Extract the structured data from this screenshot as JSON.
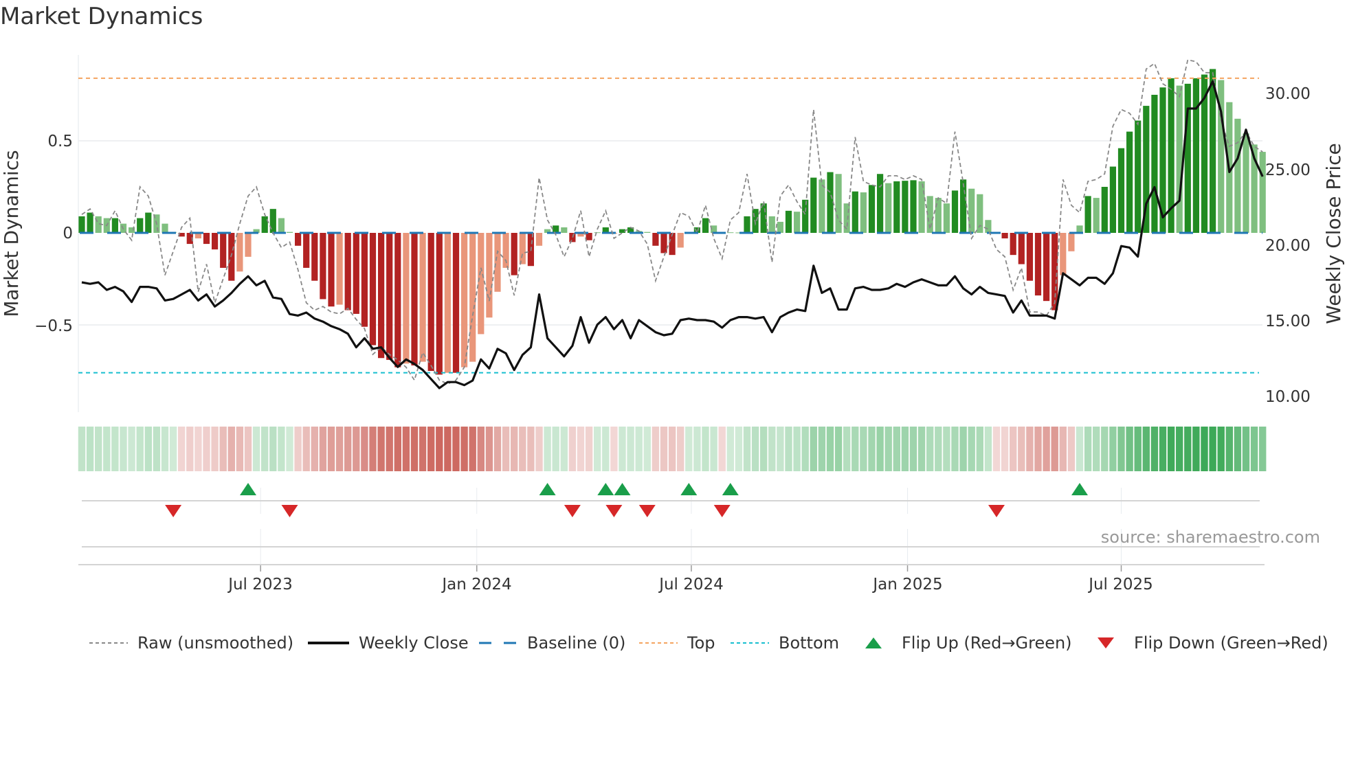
{
  "title": "Market Dynamics",
  "source": "source: sharemaestro.com",
  "colors": {
    "green_dark": "#228b22",
    "green_light": "#7fbf7f",
    "red_dark": "#b22222",
    "red_light": "#e9967a",
    "raw": "#888888",
    "close": "#111111",
    "baseline": "#1f77b4",
    "top": "#f4a460",
    "bottom": "#17becf",
    "flip_up": "#1a9e4a",
    "flip_down": "#d62728"
  },
  "legend": [
    {
      "label": "Raw (unsmoothed)",
      "icon": "dashed-gray-line"
    },
    {
      "label": "Weekly Close",
      "icon": "solid-black-line"
    },
    {
      "label": "Baseline (0)",
      "icon": "dashed-blue-line"
    },
    {
      "label": "Top",
      "icon": "dotted-orange-line"
    },
    {
      "label": "Bottom",
      "icon": "dotted-cyan-line"
    },
    {
      "label": "Flip Up (Red→Green)",
      "icon": "triangle-up"
    },
    {
      "label": "Flip Down (Green→Red)",
      "icon": "triangle-down"
    }
  ],
  "chart_data": {
    "type": "bar",
    "title": "Market Dynamics",
    "ylabel": "Market Dynamics",
    "y2label": "Weekly Close Price",
    "frequency": "weekly",
    "ylim": [
      -0.97,
      1.0
    ],
    "y2lim": [
      9.0,
      33.0
    ],
    "left_ticks": [
      "0.5",
      "0",
      "−0.5"
    ],
    "left_tick_values": [
      0.5,
      0,
      -0.5
    ],
    "right_ticks": [
      "30.00",
      "25.00",
      "20.00",
      "15.00",
      "10.00"
    ],
    "right_tick_values": [
      30,
      25,
      20,
      15,
      10
    ],
    "x_ticks": [
      "Jul 2023",
      "Jan 2024",
      "Jul 2024",
      "Jan 2025",
      "Jul 2025"
    ],
    "x_tick_week_index": [
      21.5,
      47.5,
      73.3,
      99.3,
      125
    ],
    "top_level": 0.84,
    "bottom_level": -0.76,
    "baseline": 0,
    "momentum": [
      0.09,
      0.11,
      0.09,
      0.08,
      0.08,
      0.05,
      0.03,
      0.08,
      0.11,
      0.1,
      0.05,
      0.005,
      -0.02,
      -0.06,
      -0.03,
      -0.06,
      -0.09,
      -0.19,
      -0.26,
      -0.21,
      -0.13,
      0.02,
      0.09,
      0.13,
      0.08,
      0.005,
      -0.07,
      -0.19,
      -0.26,
      -0.36,
      -0.4,
      -0.39,
      -0.42,
      -0.44,
      -0.51,
      -0.61,
      -0.68,
      -0.69,
      -0.73,
      -0.71,
      -0.72,
      -0.7,
      -0.75,
      -0.77,
      -0.76,
      -0.76,
      -0.73,
      -0.7,
      -0.55,
      -0.46,
      -0.32,
      -0.19,
      -0.23,
      -0.17,
      -0.18,
      -0.07,
      0.02,
      0.04,
      0.03,
      -0.05,
      -0.02,
      -0.04,
      0.003,
      0.03,
      -0.003,
      0.02,
      0.03,
      0.01,
      0.005,
      -0.07,
      -0.11,
      -0.12,
      -0.08,
      0.003,
      0.03,
      0.08,
      0.04,
      -0.005,
      0.003,
      0.002,
      0.09,
      0.13,
      0.16,
      0.09,
      0.06,
      0.12,
      0.115,
      0.18,
      0.3,
      0.29,
      0.33,
      0.32,
      0.16,
      0.225,
      0.22,
      0.26,
      0.32,
      0.27,
      0.28,
      0.283,
      0.286,
      0.28,
      0.2,
      0.19,
      0.16,
      0.23,
      0.29,
      0.24,
      0.21,
      0.07,
      -0.005,
      -0.03,
      -0.12,
      -0.17,
      -0.26,
      -0.34,
      -0.37,
      -0.42,
      -0.23,
      -0.1,
      0.04,
      0.2,
      0.19,
      0.25,
      0.36,
      0.46,
      0.55,
      0.61,
      0.69,
      0.75,
      0.79,
      0.84,
      0.8,
      0.81,
      0.84,
      0.86,
      0.89,
      0.83,
      0.71,
      0.62,
      0.54,
      0.48,
      0.44
    ],
    "raw": [
      0.1,
      0.13,
      0.05,
      0.04,
      0.12,
      0.02,
      -0.04,
      0.25,
      0.2,
      0.05,
      -0.23,
      -0.1,
      0.03,
      0.08,
      -0.32,
      -0.17,
      -0.38,
      -0.25,
      -0.12,
      0.05,
      0.2,
      0.25,
      0.1,
      0.0,
      -0.08,
      -0.05,
      -0.2,
      -0.38,
      -0.42,
      -0.4,
      -0.43,
      -0.44,
      -0.41,
      -0.47,
      -0.52,
      -0.66,
      -0.62,
      -0.66,
      -0.69,
      -0.73,
      -0.8,
      -0.65,
      -0.72,
      -0.8,
      -0.82,
      -0.8,
      -0.73,
      -0.45,
      -0.19,
      -0.37,
      -0.1,
      -0.15,
      -0.34,
      -0.11,
      -0.1,
      0.3,
      0.07,
      -0.01,
      -0.13,
      -0.03,
      0.12,
      -0.13,
      0.02,
      0.12,
      -0.03,
      0.0,
      0.03,
      0.01,
      -0.06,
      -0.26,
      -0.13,
      -0.01,
      0.11,
      0.09,
      0.0,
      0.15,
      -0.03,
      -0.14,
      0.07,
      0.11,
      0.32,
      0.05,
      0.17,
      -0.16,
      0.2,
      0.26,
      0.17,
      0.1,
      0.67,
      0.26,
      0.22,
      0.07,
      0.02,
      0.52,
      0.28,
      0.26,
      0.25,
      0.31,
      0.31,
      0.29,
      0.31,
      0.29,
      0.02,
      0.19,
      0.16,
      0.55,
      0.27,
      -0.03,
      0.04,
      0.02,
      -0.09,
      -0.13,
      -0.31,
      -0.19,
      -0.43,
      -0.43,
      -0.45,
      -0.38,
      0.29,
      0.15,
      0.11,
      0.28,
      0.29,
      0.32,
      0.58,
      0.67,
      0.65,
      0.59,
      0.89,
      0.92,
      0.81,
      0.78,
      0.74,
      0.94,
      0.93,
      0.87,
      0.87,
      0.61,
      0.47,
      0.49,
      0.55,
      0.47,
      0.44
    ],
    "close": [
      17.5,
      17.4,
      17.5,
      17.0,
      17.2,
      16.9,
      16.2,
      17.2,
      17.2,
      17.1,
      16.3,
      16.4,
      16.7,
      17.0,
      16.3,
      16.7,
      15.9,
      16.3,
      16.8,
      17.4,
      17.9,
      17.3,
      17.6,
      16.5,
      16.4,
      15.4,
      15.3,
      15.5,
      15.1,
      14.9,
      14.6,
      14.4,
      14.1,
      13.2,
      13.8,
      13.1,
      13.2,
      12.5,
      11.9,
      12.4,
      12.1,
      11.7,
      11.1,
      10.5,
      10.9,
      10.9,
      10.7,
      11.0,
      12.4,
      11.8,
      13.1,
      12.8,
      11.7,
      12.7,
      13.2,
      16.7,
      13.8,
      13.2,
      12.6,
      13.3,
      15.2,
      13.5,
      14.7,
      15.2,
      14.4,
      15.0,
      13.8,
      15.0,
      14.6,
      14.2,
      14.0,
      14.1,
      15.0,
      15.1,
      15.0,
      15.0,
      14.9,
      14.5,
      15.0,
      15.2,
      15.2,
      15.1,
      15.2,
      14.2,
      15.2,
      15.5,
      15.7,
      15.6,
      18.6,
      16.8,
      17.1,
      15.7,
      15.7,
      17.1,
      17.2,
      17.0,
      17.0,
      17.1,
      17.4,
      17.2,
      17.5,
      17.7,
      17.5,
      17.3,
      17.3,
      17.9,
      17.1,
      16.7,
      17.2,
      16.8,
      16.7,
      16.6,
      15.5,
      16.3,
      15.3,
      15.3,
      15.3,
      15.1,
      18.1,
      17.7,
      17.3,
      17.8,
      17.8,
      17.4,
      18.1,
      19.9,
      19.8,
      19.2,
      22.7,
      23.8,
      21.8,
      22.4,
      22.9,
      29.0,
      29.0,
      29.7,
      30.8,
      28.8,
      24.8,
      25.7,
      27.6,
      25.7,
      24.5
    ],
    "flip_up_week_index": [
      20,
      56,
      63,
      65,
      73,
      78,
      120
    ],
    "flip_down_week_index": [
      11,
      25,
      59,
      64,
      68,
      77,
      110
    ]
  }
}
